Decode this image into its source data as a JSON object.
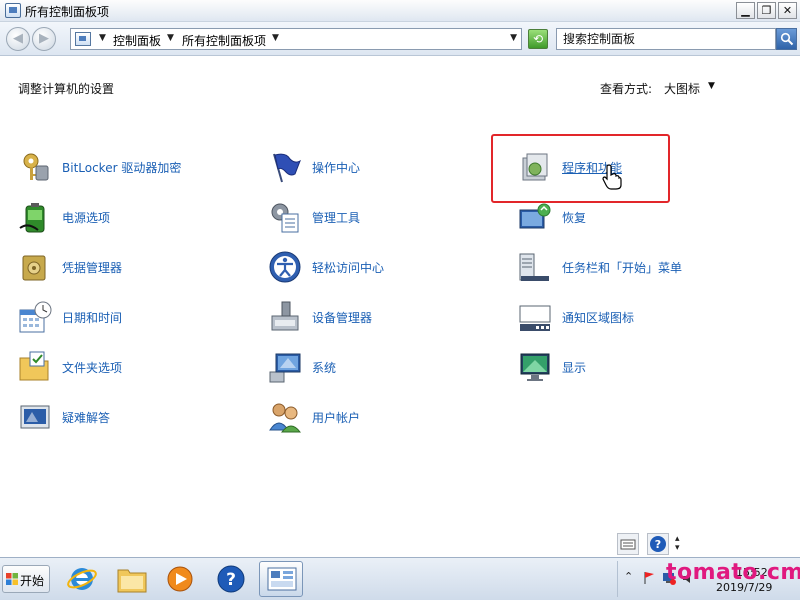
{
  "window": {
    "title": "所有控制面板项",
    "minimize": "▁",
    "restore": "❐",
    "close": "✕"
  },
  "address": {
    "crumbs": [
      "控制面板",
      "所有控制面板项"
    ],
    "search_placeholder": "搜索控制面板"
  },
  "header": {
    "adjust_label": "调整计算机的设置",
    "view_by_label": "查看方式:",
    "view_by_value": "大图标"
  },
  "items": [
    {
      "label": "BitLocker 驱动器加密",
      "icon": "bitlocker-key-icon"
    },
    {
      "label": "操作中心",
      "icon": "flag-icon"
    },
    {
      "label": "程序和功能",
      "icon": "programs-box-icon",
      "hovered": true
    },
    {
      "label": "电源选项",
      "icon": "battery-icon"
    },
    {
      "label": "管理工具",
      "icon": "admin-tools-icon"
    },
    {
      "label": "恢复",
      "icon": "recovery-monitor-icon"
    },
    {
      "label": "凭据管理器",
      "icon": "vault-icon"
    },
    {
      "label": "轻松访问中心",
      "icon": "accessibility-icon"
    },
    {
      "label": "任务栏和「开始」菜单",
      "icon": "taskbar-icon"
    },
    {
      "label": "日期和时间",
      "icon": "calendar-clock-icon"
    },
    {
      "label": "设备管理器",
      "icon": "device-manager-icon"
    },
    {
      "label": "通知区域图标",
      "icon": "notification-area-icon"
    },
    {
      "label": "文件夹选项",
      "icon": "folder-options-icon"
    },
    {
      "label": "系统",
      "icon": "system-icon"
    },
    {
      "label": "显示",
      "icon": "display-icon"
    },
    {
      "label": "疑难解答",
      "icon": "troubleshoot-icon"
    },
    {
      "label": "用户帐户",
      "icon": "users-icon"
    }
  ],
  "taskbar": {
    "start_label": "开始",
    "apps": [
      "internet-explorer-icon",
      "explorer-icon",
      "media-player-icon",
      "help-icon",
      "control-panel-icon"
    ],
    "clock_time": "15:52",
    "clock_date": "2019/7/29"
  },
  "watermark": "tomato.cm",
  "colors": {
    "link": "#1a5fb4",
    "highlight": "#e2262a",
    "watermark": "#e0197f"
  }
}
